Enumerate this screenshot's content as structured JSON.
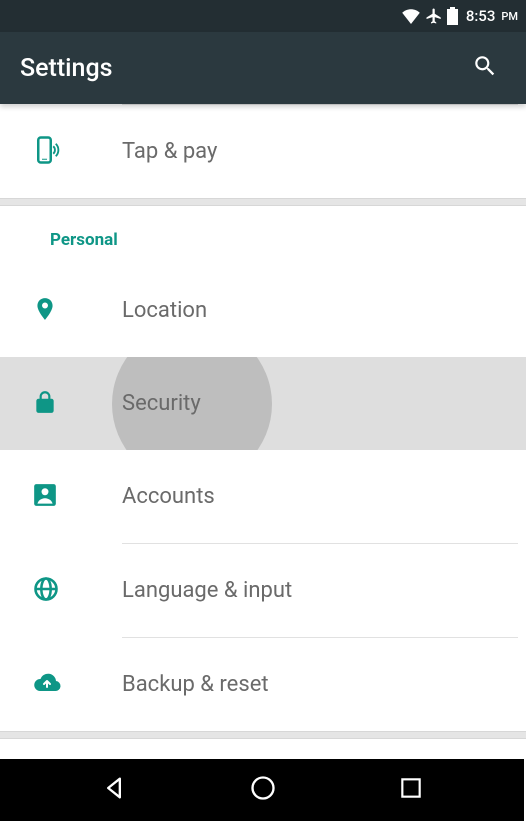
{
  "status": {
    "time": "8:53",
    "ampm": "PM"
  },
  "appbar": {
    "title": "Settings"
  },
  "items": {
    "tap_pay": "Tap & pay",
    "location": "Location",
    "security": "Security",
    "accounts": "Accounts",
    "language_input": "Language & input",
    "backup_reset": "Backup & reset"
  },
  "sections": {
    "personal": "Personal"
  },
  "colors": {
    "accent": "#0e9686",
    "appbar": "#2b393f",
    "statusbar": "#232e33"
  }
}
